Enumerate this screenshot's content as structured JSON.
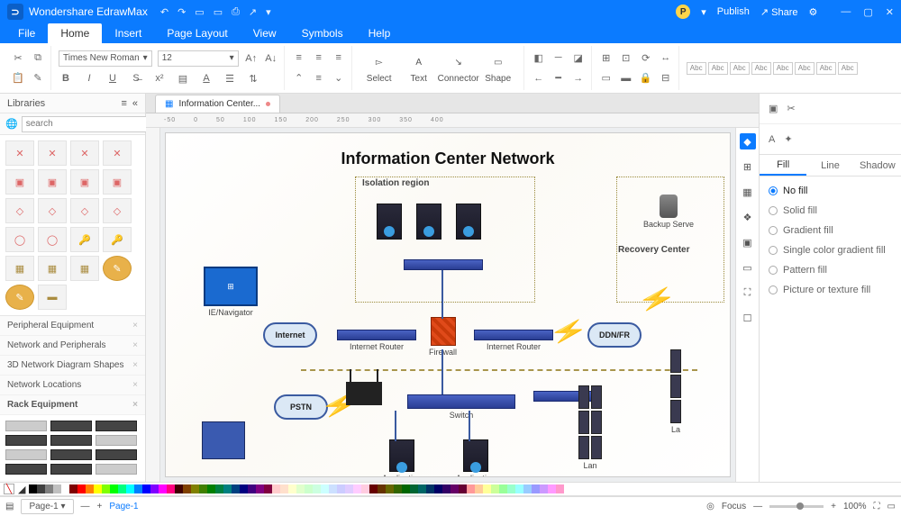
{
  "app": {
    "name": "Wondershare EdrawMax"
  },
  "title_right": {
    "publish": "Publish",
    "share": "Share"
  },
  "menu": {
    "file": "File",
    "home": "Home",
    "insert": "Insert",
    "page_layout": "Page Layout",
    "view": "View",
    "symbols": "Symbols",
    "help": "Help"
  },
  "ribbon": {
    "font": "Times New Roman",
    "size": "12",
    "select": "Select",
    "text": "Text",
    "connector": "Connector",
    "shape": "Shape",
    "style_label": "Abc"
  },
  "left": {
    "header": "Libraries",
    "search_placeholder": "search",
    "cats": [
      "Peripheral Equipment",
      "Network and Peripherals",
      "3D Network Diagram Shapes",
      "Network Locations"
    ],
    "rack": "Rack Equipment"
  },
  "doc_tab": "Information Center...",
  "diagram": {
    "title": "Information Center Network",
    "isolation": "Isolation region",
    "recovery": "Recovery Center",
    "backup": "Backup Serve",
    "ie": "IE/Navigator",
    "internet": "Internet",
    "router": "Internet Router",
    "firewall": "Firewall",
    "ddn": "DDN/FR",
    "pstn": "PSTN",
    "switch": "Switch",
    "application": "Application",
    "lan": "Lan",
    "lan2": "La"
  },
  "right": {
    "tabs": {
      "fill": "Fill",
      "line": "Line",
      "shadow": "Shadow"
    },
    "opts": {
      "no_fill": "No fill",
      "solid": "Solid fill",
      "gradient": "Gradient fill",
      "single": "Single color gradient fill",
      "pattern": "Pattern fill",
      "picture": "Picture or texture fill"
    }
  },
  "status": {
    "page": "Page-1",
    "page_link": "Page-1",
    "focus": "Focus",
    "zoom": "100%"
  },
  "ruler_marks": [
    "-50",
    "0",
    "50",
    "100",
    "150",
    "200",
    "250",
    "300",
    "350",
    "400"
  ]
}
